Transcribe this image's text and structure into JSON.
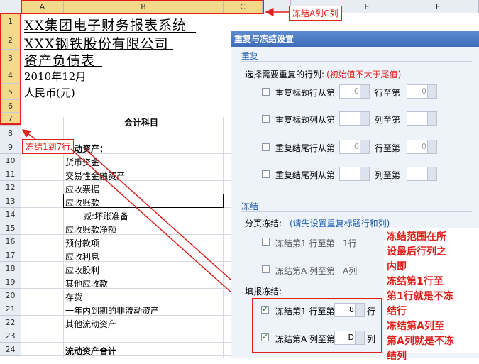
{
  "sheet": {
    "columns": [
      "A",
      "B",
      "C",
      "E",
      "F"
    ],
    "rows": [
      "1",
      "2",
      "3",
      "4",
      "5",
      "6",
      "7",
      "8",
      "9",
      "10",
      "11",
      "12",
      "13",
      "14",
      "15",
      "16",
      "17",
      "18",
      "19",
      "20",
      "21",
      "22",
      "23",
      "24"
    ],
    "title1": "XX集团电子财务报表系统",
    "title2": "XXX钢铁股份有限公司",
    "title3": "资产负债表",
    "date": "2010年12月",
    "currency": "人民币(元)",
    "header": "会计科目",
    "items": [
      "流动资产：",
      "货币资金",
      "交易性金融资产",
      "应收票据",
      "应收账款",
      "减:坏账准备",
      "应收账款净额",
      "预付款项",
      "应收利息",
      "应收股利",
      "其他应收款",
      "存货",
      "一年内到期的非流动资产",
      "其他流动资产",
      "",
      "流动资产合计"
    ]
  },
  "annotations": {
    "freeze_cols": "冻结A到C列",
    "freeze_rows": "冻结1到7行",
    "note_lines": [
      "冻结范围在所",
      "设最后行列之",
      "内即",
      "冻结第1行至",
      "第1行就是不冻",
      "结行",
      "冻结第A列至",
      "第A列就是不冻",
      "结列"
    ]
  },
  "dialog": {
    "title": "重复与冻结设置",
    "repeat_section": "重复",
    "repeat_prompt": "选择需要重复的行列:",
    "repeat_hint": "(初始值不大于尾值)",
    "repeat_rows": [
      {
        "label": "重复标题行从第",
        "from": "0",
        "to_label": "行至第",
        "to": "0"
      },
      {
        "label": "重复标题列从第",
        "from": "",
        "to_label": "列至第",
        "to": ""
      },
      {
        "label": "重复结尾行从第",
        "from": "0",
        "to_label": "行至第",
        "to": "0"
      },
      {
        "label": "重复结尾列从第",
        "from": "",
        "to_label": "列至第",
        "to": ""
      }
    ],
    "freeze_section": "冻结",
    "page_freeze_label": "分页冻结:",
    "page_freeze_hint": "(请先设置重复标题行和列)",
    "page_freeze_row": {
      "label": "冻结第1 行至第",
      "value": "1行"
    },
    "page_freeze_col": {
      "label": "冻结第A 列至第",
      "value": "A列"
    },
    "fill_freeze_label": "填报冻结:",
    "fill_freeze_row": {
      "label": "冻结第1 行至第",
      "value": "8",
      "unit": "行"
    },
    "fill_freeze_col": {
      "label": "冻结第A 列至第",
      "value": "D",
      "unit": "列"
    }
  },
  "colors": {
    "accent_red": "#e0201c",
    "dialog_title": "#3d6db8",
    "selection": "#f5d98a"
  }
}
